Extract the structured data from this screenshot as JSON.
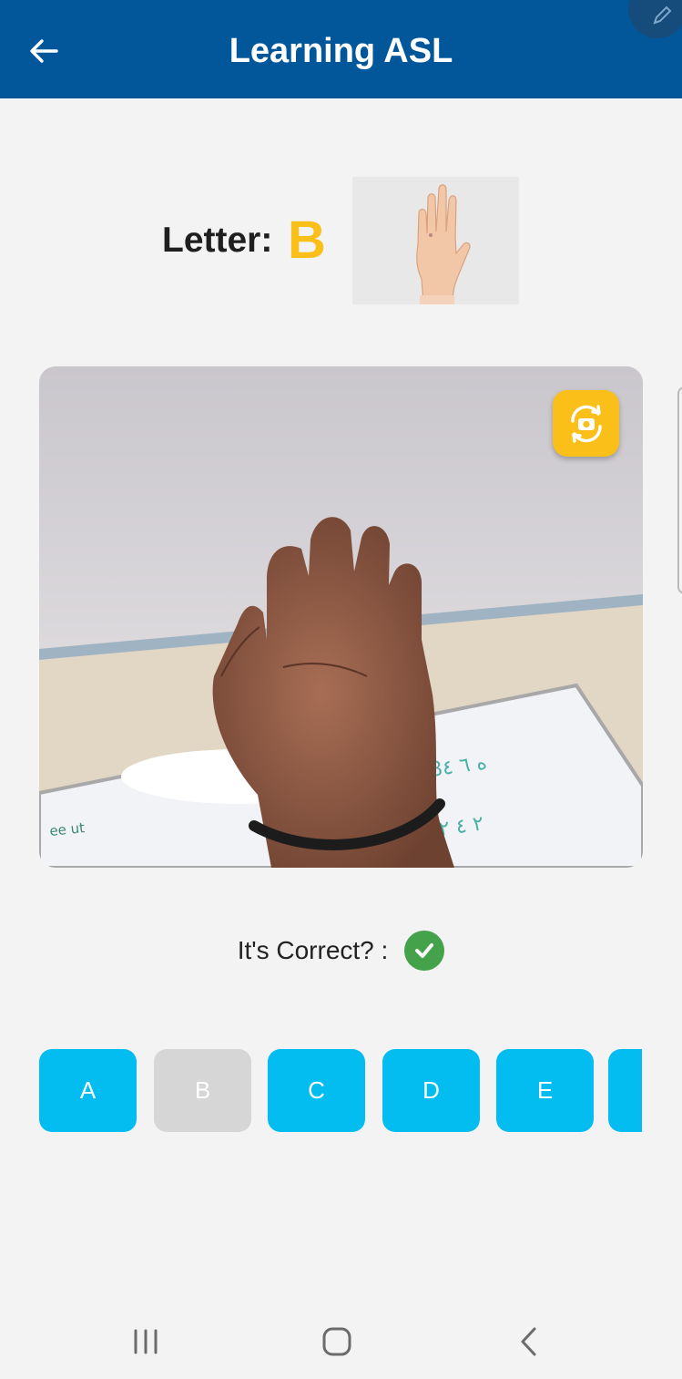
{
  "header": {
    "title": "Learning ASL",
    "back_icon": "arrow-left-icon",
    "edit_icon": "pencil-icon",
    "color": "#02579a"
  },
  "lesson": {
    "letter_label": "Letter:",
    "current_letter": "B",
    "letter_color": "#fbbf1a",
    "reference_image": "asl-letter-b-hand-sign"
  },
  "camera": {
    "content": "live-camera-preview-hand-sign",
    "flip_icon": "camera-switch-icon"
  },
  "result": {
    "label": "It's Correct? :",
    "status_icon": "check-circle-icon",
    "status_color": "#43a24a"
  },
  "letters": [
    {
      "label": "A",
      "state": "enabled"
    },
    {
      "label": "B",
      "state": "selected"
    },
    {
      "label": "C",
      "state": "enabled"
    },
    {
      "label": "D",
      "state": "enabled"
    },
    {
      "label": "E",
      "state": "enabled"
    },
    {
      "label": "",
      "state": "enabled"
    }
  ],
  "colors": {
    "letter_button": "#03bdf1",
    "letter_button_selected": "#d6d6d6",
    "accent": "#fbbf1a"
  },
  "nav": {
    "recent_icon": "recent-apps-icon",
    "home_icon": "home-icon",
    "back_icon": "back-chevron-icon"
  }
}
